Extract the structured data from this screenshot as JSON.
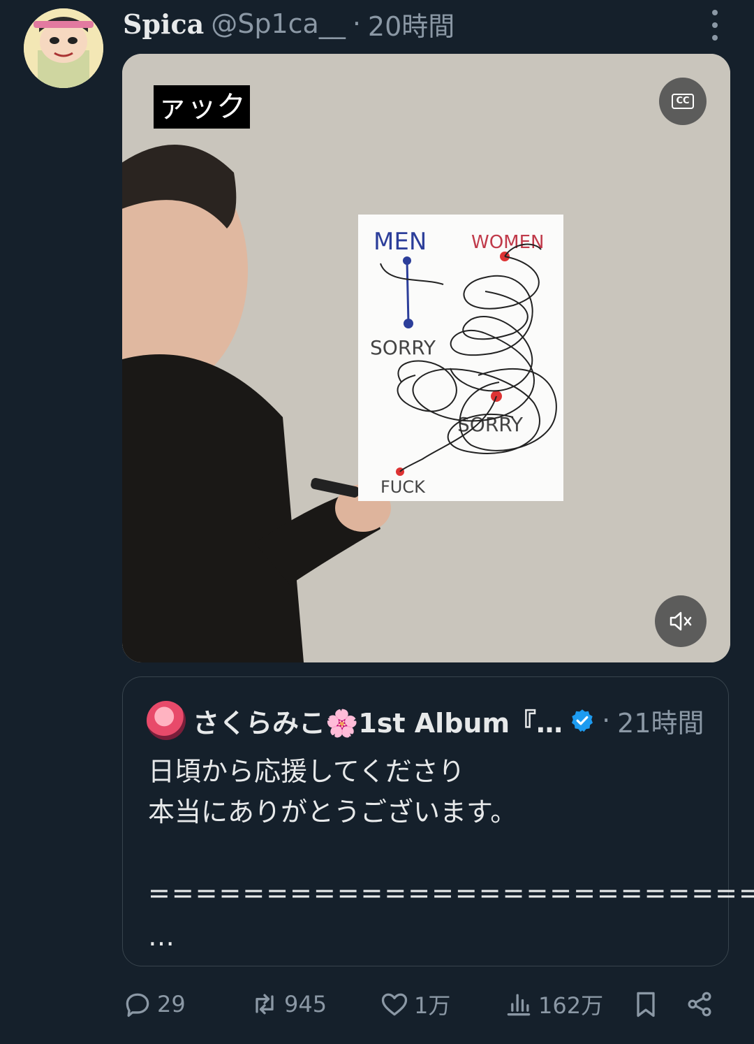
{
  "tweet": {
    "display_name": "Spica",
    "handle": "@Sp1ca__",
    "separator": "·",
    "time": "20時間",
    "media": {
      "caption": "ァック",
      "cc_label": "CC",
      "poster": {
        "labels": [
          "MEN",
          "WOMEN",
          "SORRY",
          "SORRY",
          "FUCK"
        ]
      }
    }
  },
  "quote": {
    "display_name": "さくらみこ🌸1st Album『…",
    "separator": "·",
    "time": "21時間",
    "lines": [
      "日頃から応援してくださり",
      "本当にありがとうございます。",
      "",
      "==========================",
      "…"
    ]
  },
  "actions": {
    "reply_count": "29",
    "retweet_count": "945",
    "like_count": "1万",
    "views_count": "162万"
  },
  "colors": {
    "background": "#15202b",
    "secondary_text": "#8b98a5",
    "verified": "#1d9bf0"
  }
}
